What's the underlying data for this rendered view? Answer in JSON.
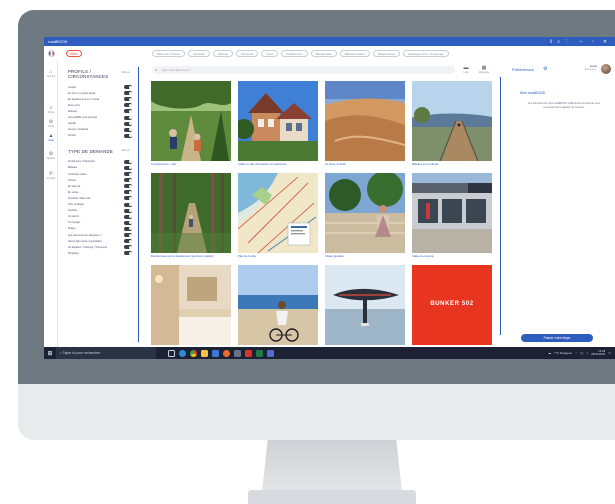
{
  "window": {
    "title": "roadBOOK"
  },
  "topbar": {
    "filter_label": "Initier",
    "chips": [
      "Mots-clés choisis",
      "Contexte",
      "Rythme",
      "Parcours",
      "Lieux",
      "Préférences",
      "Restaurants",
      "Balades nature",
      "Randonnées",
      "Hébergements / Campings"
    ]
  },
  "rail": [
    {
      "icon": "house-icon",
      "label": "Accueil",
      "active": false
    },
    {
      "icon": "search-icon",
      "label": "Filtres",
      "active": false
    },
    {
      "icon": "gear-icon",
      "label": "Outils",
      "active": false
    },
    {
      "icon": "map-icon",
      "label": "Carte",
      "active": true
    },
    {
      "icon": "gear-icon",
      "label": "Options",
      "active": false
    },
    {
      "icon": "phone-icon",
      "label": "Contact",
      "active": false
    }
  ],
  "panel": {
    "profile_title": "PROFILS / CIRCONSTANCES",
    "profile_reset": "Effacer",
    "profile_items": [
      "Couple",
      "En solo / en petite bande",
      "En déplacement pro / travail",
      "Entre amis",
      "Mariage",
      "Accessibilité (à la journée)",
      "Famille",
      "Jeunes / étudiants",
      "Séniors"
    ],
    "request_title": "TYPE DE DEMANDE",
    "request_reset": "Effacer",
    "request_items": [
      "Architecture / Patrimoine",
      "Balades",
      "Curiosités nature",
      "Culture",
      "En plein air",
      "En soirée",
      "Fondants / Bien-être",
      "Infos pratiques",
      "Insolites",
      "Où dormir",
      "Où manger",
      "Plages",
      "Que découvrir aux alentours ?",
      "Savoir-faire local et spécialités",
      "Se déplacer / Parkings / Transports",
      "Shopping"
    ]
  },
  "search": {
    "placeholder": "Que cherchez-vous ?"
  },
  "view_buttons": [
    {
      "icon": "list-icon",
      "label": "Liste"
    },
    {
      "icon": "grid-icon",
      "label": "Mosaïque"
    }
  ],
  "cards": [
    {
      "caption": "Cyclotourisme / vélo"
    },
    {
      "caption": "Visiter la ville d'Arcachon en patrimoine"
    },
    {
      "caption": "La Dune du Pilat"
    },
    {
      "caption": "Balades sur le littoral"
    },
    {
      "caption": "Randonnées sur le département (parcours guidés)"
    },
    {
      "caption": "Plan de la ville"
    },
    {
      "caption": "Visites guidées"
    },
    {
      "caption": "Salles de cinéma"
    },
    {
      "caption": ""
    },
    {
      "caption": ""
    },
    {
      "caption": ""
    },
    {
      "caption": "BUNKER 502"
    }
  ],
  "prefs": {
    "title": "Préférences",
    "user_name": "Lucie",
    "user_role": "Bienvenue !",
    "roadbook_title": "Mon roadBOOK",
    "roadbook_desc": "Les éléments de votre roadBOOK s'afficheront ici lorsque vous commencerez à ajouter du contenu.",
    "cta": "Passer votre étape"
  },
  "taskbar": {
    "search_placeholder": "Taper ici pour rechercher",
    "weather": "7°C Nuageux",
    "time": "14:03",
    "date": "28/01/2022"
  }
}
